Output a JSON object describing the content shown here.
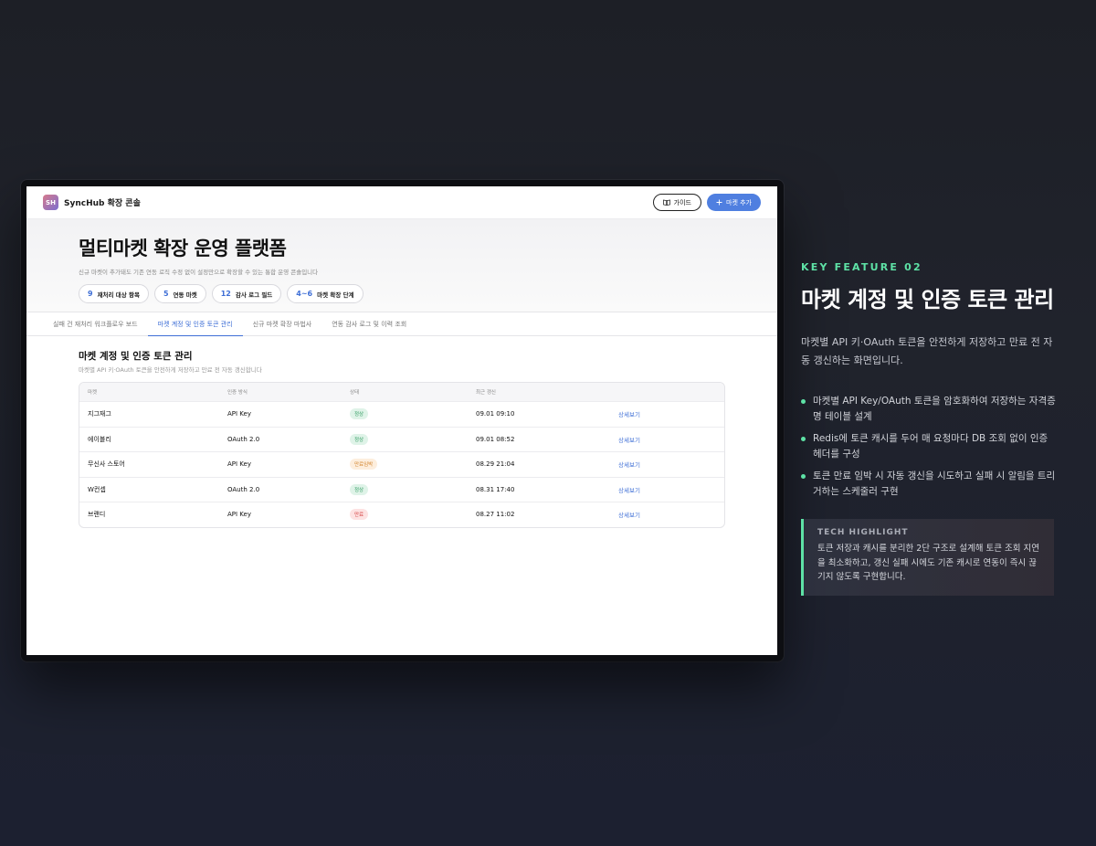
{
  "app": {
    "logo_text": "SH",
    "brand_name": "SyncHub 확장 콘솔",
    "guide_label": "가이드",
    "add_market_label": "마켓 추가"
  },
  "hero": {
    "title": "멀티마켓 확장 운영 플랫폼",
    "subtitle": "신규 마켓이 추가돼도 기존 연동 로직 수정 없이 설정만으로 확장할 수 있는 통합 운영 콘솔입니다",
    "stats": [
      {
        "num": "9",
        "label": "재처리 대상 항목"
      },
      {
        "num": "5",
        "label": "연동 마켓"
      },
      {
        "num": "12",
        "label": "감사 로그 필드"
      },
      {
        "num": "4~6",
        "label": "마켓 확장 단계"
      }
    ]
  },
  "tabs": [
    {
      "label": "실패 건 재처리 워크플로우 보드",
      "active": false
    },
    {
      "label": "마켓 계정 및 인증 토큰 관리",
      "active": true
    },
    {
      "label": "신규 마켓 확장 마법사",
      "active": false
    },
    {
      "label": "연동 감사 로그 및 이력 조회",
      "active": false
    }
  ],
  "section": {
    "title": "마켓 계정 및 인증 토큰 관리",
    "subtitle": "마켓별 API 키·OAuth 토큰을 안전하게 저장하고 만료 전 자동 갱신합니다"
  },
  "table": {
    "headers": [
      "마켓",
      "인증 방식",
      "상태",
      "최근 갱신",
      ""
    ],
    "rows": [
      {
        "market": "지그재그",
        "auth": "API Key",
        "status": "정상",
        "status_type": "ok",
        "updated": "09.01 09:10",
        "action": "상세보기"
      },
      {
        "market": "에이블리",
        "auth": "OAuth 2.0",
        "status": "정상",
        "status_type": "ok",
        "updated": "09.01 08:52",
        "action": "상세보기"
      },
      {
        "market": "무신사 스토어",
        "auth": "API Key",
        "status": "만료임박",
        "status_type": "warn",
        "updated": "08.29 21:04",
        "action": "상세보기"
      },
      {
        "market": "W컨셉",
        "auth": "OAuth 2.0",
        "status": "정상",
        "status_type": "ok",
        "updated": "08.31 17:40",
        "action": "상세보기"
      },
      {
        "market": "브랜디",
        "auth": "API Key",
        "status": "만료",
        "status_type": "exp",
        "updated": "08.27 11:02",
        "action": "상세보기"
      }
    ]
  },
  "feature": {
    "kicker": "KEY FEATURE 02",
    "title": "마켓 계정 및 인증 토큰 관리",
    "description": "마켓별 API 키·OAuth 토큰을 안전하게 저장하고 만료 전 자동 갱신하는 화면입니다.",
    "bullets": [
      "마켓별 API Key/OAuth 토큰을 암호화하여 저장하는 자격증명 테이블 설계",
      "Redis에 토큰 캐시를 두어 매 요청마다 DB 조회 없이 인증 헤더를 구성",
      "토큰 만료 임박 시 자동 갱신을 시도하고 실패 시 알림을 트리거하는 스케줄러 구현"
    ],
    "highlight_title": "TECH HIGHLIGHT",
    "highlight_text": "토큰 저장과 캐시를 분리한 2단 구조로 설계해 토큰 조회 지연을 최소화하고, 갱신 실패 시에도 기존 캐시로 연동이 즉시 끊기지 않도록 구현합니다."
  },
  "colors": {
    "accent_blue": "#4f7fe0",
    "accent_green": "#5ee2a6",
    "status_ok": "#2f9b5f",
    "status_warn": "#d4862f",
    "status_expired": "#d64545"
  }
}
